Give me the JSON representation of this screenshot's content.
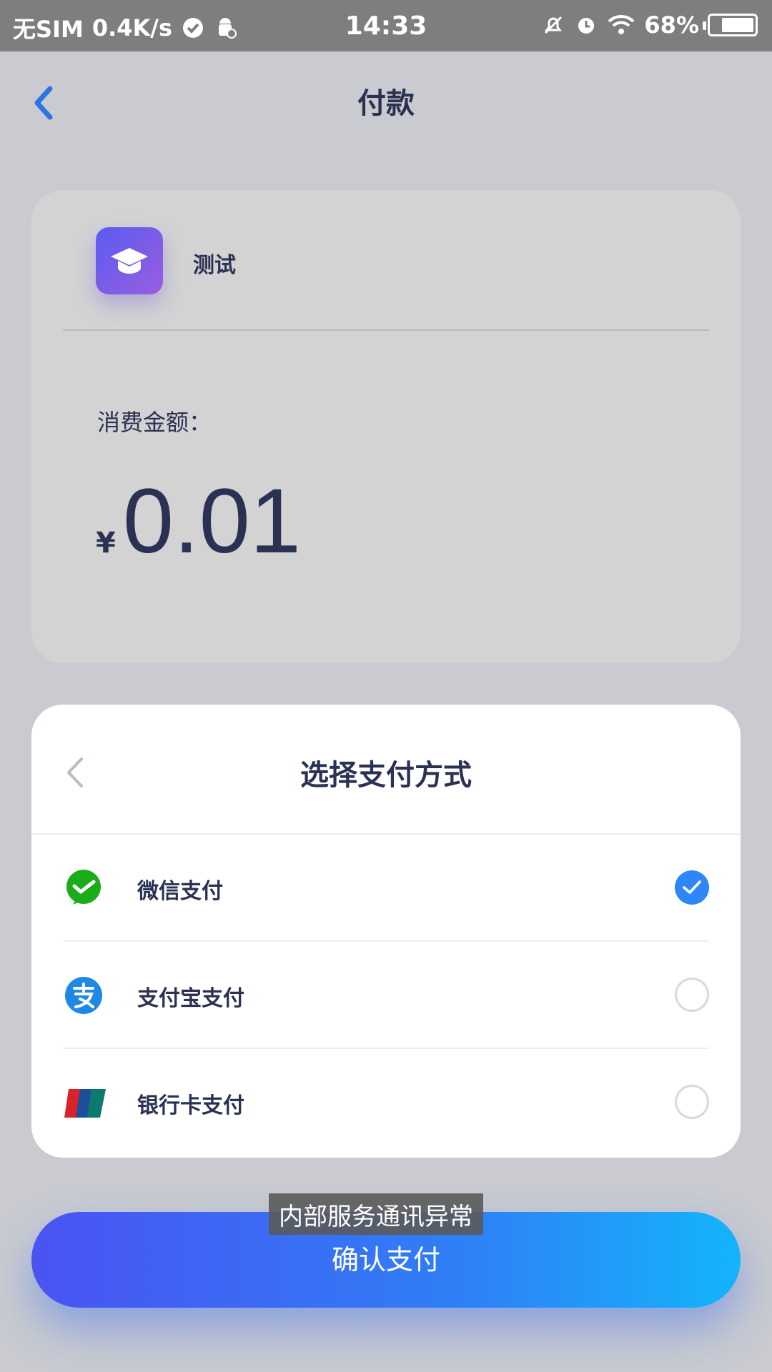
{
  "status_bar": {
    "carrier": "无SIM",
    "speed": "0.4K/s",
    "time": "14:33",
    "battery": "68%",
    "icons": [
      "check-circle-icon",
      "android-icon",
      "mute-bell-icon",
      "alarm-icon",
      "wifi-icon",
      "battery-icon"
    ]
  },
  "header": {
    "title": "付款",
    "back_icon": "chevron-left-icon"
  },
  "merchant": {
    "name": "测试",
    "logo_icon": "graduation-cap-icon"
  },
  "amount": {
    "label": "消费金额：",
    "currency": "¥",
    "value": "0.01"
  },
  "payment_sheet": {
    "title": "选择支付方式",
    "options": [
      {
        "label": "微信支付",
        "icon": "wechat-pay-icon",
        "selected": true
      },
      {
        "label": "支付宝支付",
        "icon": "alipay-icon",
        "selected": false
      },
      {
        "label": "银行卡支付",
        "icon": "unionpay-icon",
        "selected": false
      }
    ]
  },
  "toast": "内部服务通讯异常",
  "confirm_button": "确认支付",
  "colors": {
    "accent": "#2f86f6",
    "text": "#2a3153",
    "wechat": "#1aad19",
    "alipay": "#1e88e5"
  }
}
